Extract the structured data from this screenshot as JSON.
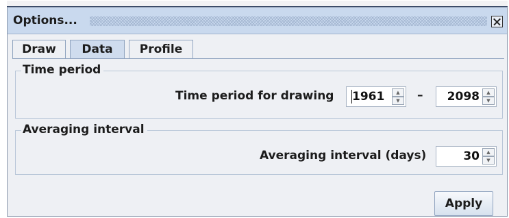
{
  "window": {
    "title": "Options..."
  },
  "tabs": [
    {
      "label": "Draw",
      "active": false
    },
    {
      "label": "Data",
      "active": true
    },
    {
      "label": "Profile",
      "active": false
    }
  ],
  "time_period": {
    "group_title": "Time period",
    "label": "Time period for drawing",
    "start": "1961",
    "separator": "–",
    "end": "2098"
  },
  "averaging": {
    "group_title": "Averaging interval",
    "label": "Averaging interval (days)",
    "value": "30"
  },
  "buttons": {
    "apply": "Apply"
  },
  "icons": {
    "close": "close-icon",
    "spin_up": "chevron-up-icon",
    "spin_down": "chevron-down-icon"
  },
  "colors": {
    "titlebar": "#c9d9ee",
    "panel": "#eef0f4",
    "border": "#8fa3bf"
  }
}
